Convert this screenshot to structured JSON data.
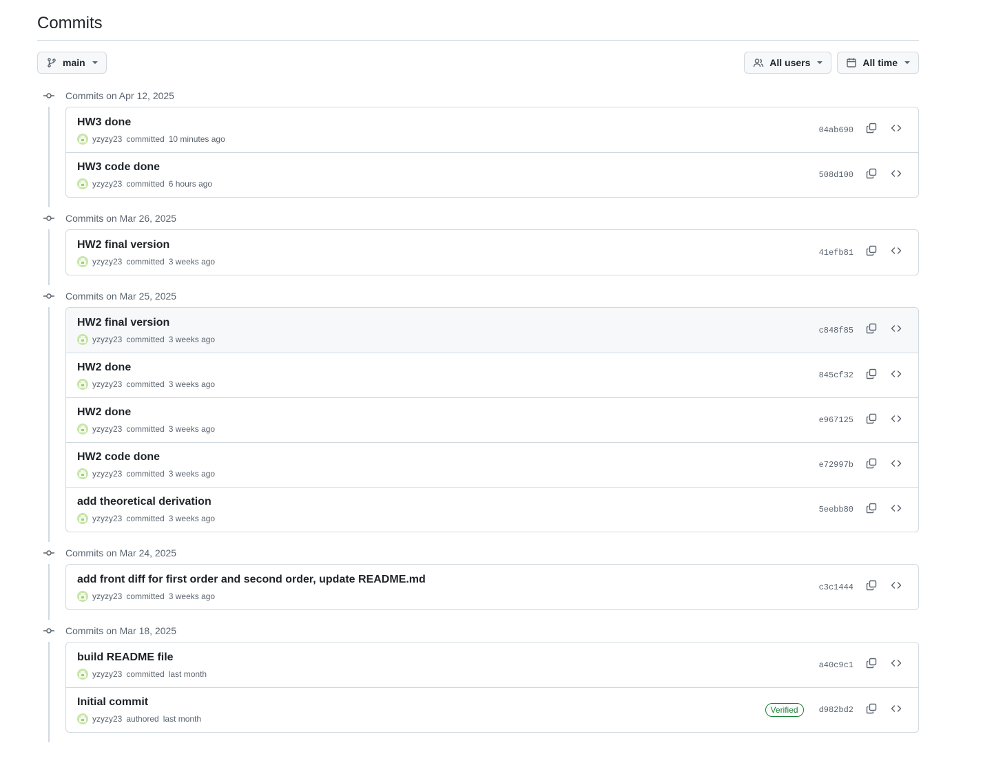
{
  "page": {
    "title": "Commits"
  },
  "toolbar": {
    "branch_label": "main",
    "users_label": "All users",
    "time_label": "All time"
  },
  "groups": [
    {
      "header": "Commits on Apr 12, 2025",
      "commits": [
        {
          "message": "HW3 done",
          "author": "yzyzy23",
          "action": "committed",
          "time": "10 minutes ago",
          "sha": "04ab690"
        },
        {
          "message": "HW3 code done",
          "author": "yzyzy23",
          "action": "committed",
          "time": "6 hours ago",
          "sha": "508d100"
        }
      ]
    },
    {
      "header": "Commits on Mar 26, 2025",
      "commits": [
        {
          "message": "HW2 final version",
          "author": "yzyzy23",
          "action": "committed",
          "time": "3 weeks ago",
          "sha": "41efb81"
        }
      ]
    },
    {
      "header": "Commits on Mar 25, 2025",
      "commits": [
        {
          "message": "HW2 final version",
          "author": "yzyzy23",
          "action": "committed",
          "time": "3 weeks ago",
          "sha": "c848f85"
        },
        {
          "message": "HW2 done",
          "author": "yzyzy23",
          "action": "committed",
          "time": "3 weeks ago",
          "sha": "845cf32"
        },
        {
          "message": "HW2 done",
          "author": "yzyzy23",
          "action": "committed",
          "time": "3 weeks ago",
          "sha": "e967125"
        },
        {
          "message": "HW2 code done",
          "author": "yzyzy23",
          "action": "committed",
          "time": "3 weeks ago",
          "sha": "e72997b"
        },
        {
          "message": "add theoretical derivation",
          "author": "yzyzy23",
          "action": "committed",
          "time": "3 weeks ago",
          "sha": "5eebb80"
        }
      ]
    },
    {
      "header": "Commits on Mar 24, 2025",
      "commits": [
        {
          "message": "add front diff for first order and second order, update README.md",
          "author": "yzyzy23",
          "action": "committed",
          "time": "3 weeks ago",
          "sha": "c3c1444"
        }
      ]
    },
    {
      "header": "Commits on Mar 18, 2025",
      "commits": [
        {
          "message": "build README file",
          "author": "yzyzy23",
          "action": "committed",
          "time": "last month",
          "sha": "a40c9c1"
        },
        {
          "message": "Initial commit",
          "author": "yzyzy23",
          "action": "authored",
          "time": "last month",
          "sha": "d982bd2",
          "badge": "Verified"
        }
      ]
    }
  ],
  "icons": {
    "branch": "git-branch-icon",
    "users": "people-icon",
    "calendar": "calendar-icon",
    "commit_node": "git-commit-icon",
    "copy": "copy-icon",
    "browse": "code-icon",
    "avatar": "identicon-avatar"
  },
  "colors": {
    "border": "#d1d9e0",
    "muted_text": "#59636e",
    "verified_green": "#1a7f37",
    "avatar_green": "#c8e6a8",
    "row_hover": "#f6f8fa"
  }
}
